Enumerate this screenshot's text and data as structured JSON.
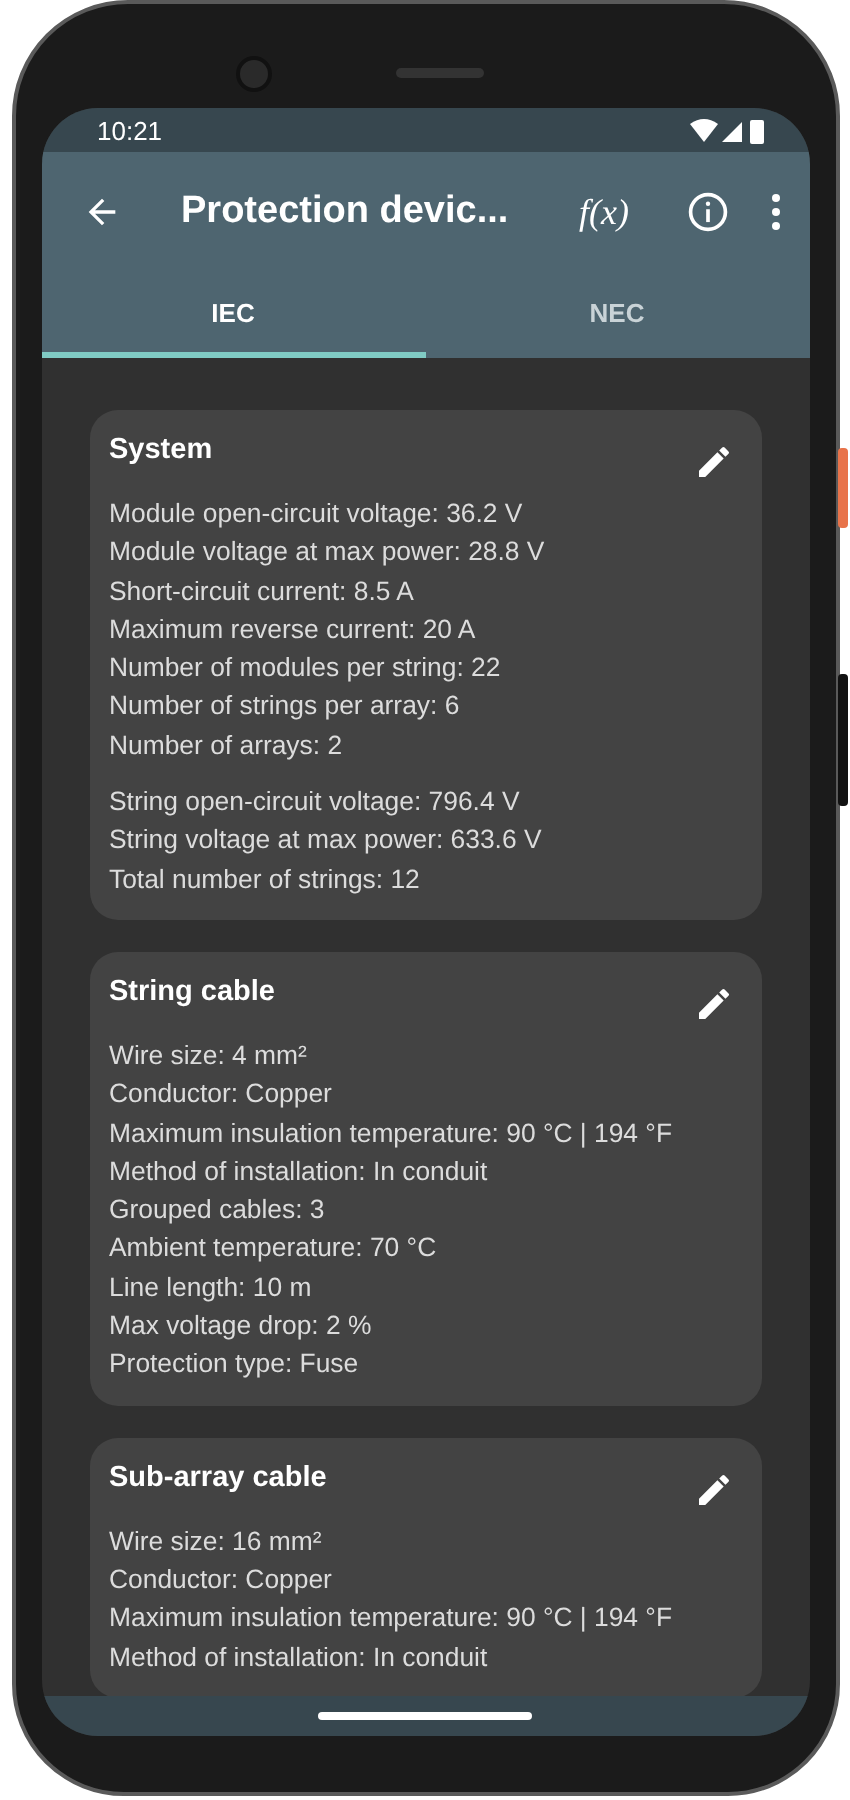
{
  "status_bar": {
    "time": "10:21"
  },
  "app_bar": {
    "title": "Protection devic...",
    "formula_button": "f(x)"
  },
  "tabs": [
    {
      "label": "IEC",
      "selected": true
    },
    {
      "label": "NEC",
      "selected": false
    }
  ],
  "cards": [
    {
      "title": "System",
      "groups": [
        [
          "Module open-circuit voltage: 36.2 V",
          "Module voltage at max power: 28.8 V",
          "Short-circuit current: 8.5 A",
          "Maximum reverse current: 20 A",
          "Number of modules per string: 22",
          "Number of strings per array: 6",
          "Number of arrays: 2"
        ],
        [
          "String open-circuit voltage: 796.4 V",
          "String voltage at max power: 633.6 V",
          "Total number of strings: 12"
        ]
      ]
    },
    {
      "title": "String cable",
      "groups": [
        [
          "Wire size: 4 mm²",
          "Conductor: Copper",
          "Maximum insulation temperature: 90 °C | 194 °F",
          "Method of installation: In conduit",
          "Grouped cables: 3",
          "Ambient temperature: 70 °C",
          "Line length: 10 m",
          "Max voltage drop: 2 %",
          "Protection type: Fuse"
        ]
      ]
    },
    {
      "title": "Sub-array cable",
      "groups": [
        [
          "Wire size: 16 mm²",
          "Conductor: Copper",
          "Maximum insulation temperature: 90 °C | 194 °F",
          "Method of installation: In conduit"
        ]
      ]
    }
  ]
}
